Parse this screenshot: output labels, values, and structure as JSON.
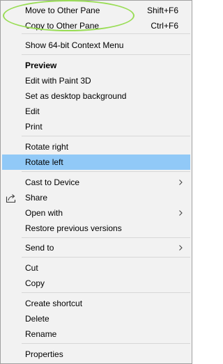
{
  "menu": {
    "items": [
      {
        "label": "Move to Other Pane",
        "shortcut": "Shift+F6"
      },
      {
        "label": "Copy to Other Pane",
        "shortcut": "Ctrl+F6"
      },
      {
        "label": "Show 64-bit Context Menu"
      },
      {
        "label": "Preview"
      },
      {
        "label": "Edit with Paint 3D"
      },
      {
        "label": "Set as desktop background"
      },
      {
        "label": "Edit"
      },
      {
        "label": "Print"
      },
      {
        "label": "Rotate right"
      },
      {
        "label": "Rotate left"
      },
      {
        "label": "Cast to Device"
      },
      {
        "label": "Share"
      },
      {
        "label": "Open with"
      },
      {
        "label": "Restore previous versions"
      },
      {
        "label": "Send to"
      },
      {
        "label": "Cut"
      },
      {
        "label": "Copy"
      },
      {
        "label": "Create shortcut"
      },
      {
        "label": "Delete"
      },
      {
        "label": "Rename"
      },
      {
        "label": "Properties"
      }
    ],
    "highlighted_item": "Rotate left",
    "annotation_color": "#99dd55",
    "highlight_color": "#91c9f7",
    "icons": {
      "share": "share-icon",
      "submenu": "chevron-right-icon"
    }
  }
}
